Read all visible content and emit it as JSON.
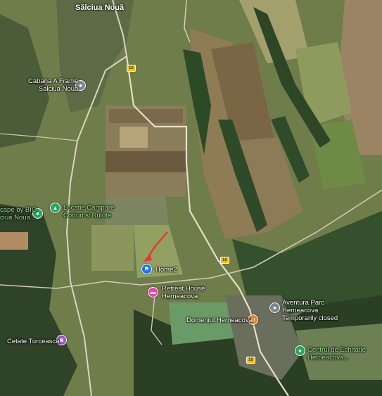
{
  "town_label": "Sălciua Nouă",
  "road_shields": [
    "10",
    "10",
    "10"
  ],
  "places": [
    {
      "line1": "Cabana A Frame",
      "line2": "Salciua Noua",
      "icon": "circle-dot-icon",
      "color": "#7d8791"
    },
    {
      "line1": "Locatie Campare",
      "line2": "Corturi si Rulote",
      "icon": "campground-icon",
      "color": "#26a65b"
    },
    {
      "line1": "cape by BIO",
      "line2": "ciua Noua...",
      "icon": "circle-dot-icon",
      "color": "#26a65b"
    },
    {
      "line1": "Home2",
      "line2": "",
      "icon": "flag-icon",
      "color": "#1a73e8"
    },
    {
      "line1": "Retreat House",
      "line2": "Herneacova",
      "icon": "hotel-icon",
      "color": "#e04aa6"
    },
    {
      "line1": "Aventura Parc",
      "line2": "Herneacova",
      "line3": "Temporarily closed",
      "icon": "circle-dot-icon",
      "color": "#7d8791"
    },
    {
      "line1": "Domeniul Herneacova",
      "line2": "",
      "icon": "restaurant-icon",
      "color": "#f07d1a"
    },
    {
      "line1": "Cetate Turceasca",
      "line2": "",
      "icon": "camera-icon",
      "color": "#9a57c8"
    },
    {
      "line1": "Centrul de Echitatie",
      "line2": "Herneacova...",
      "icon": "circle-dot-icon",
      "color": "#26a65b"
    }
  ],
  "annotation": {
    "color": "#e53935",
    "icon": "red-arrow-icon"
  }
}
